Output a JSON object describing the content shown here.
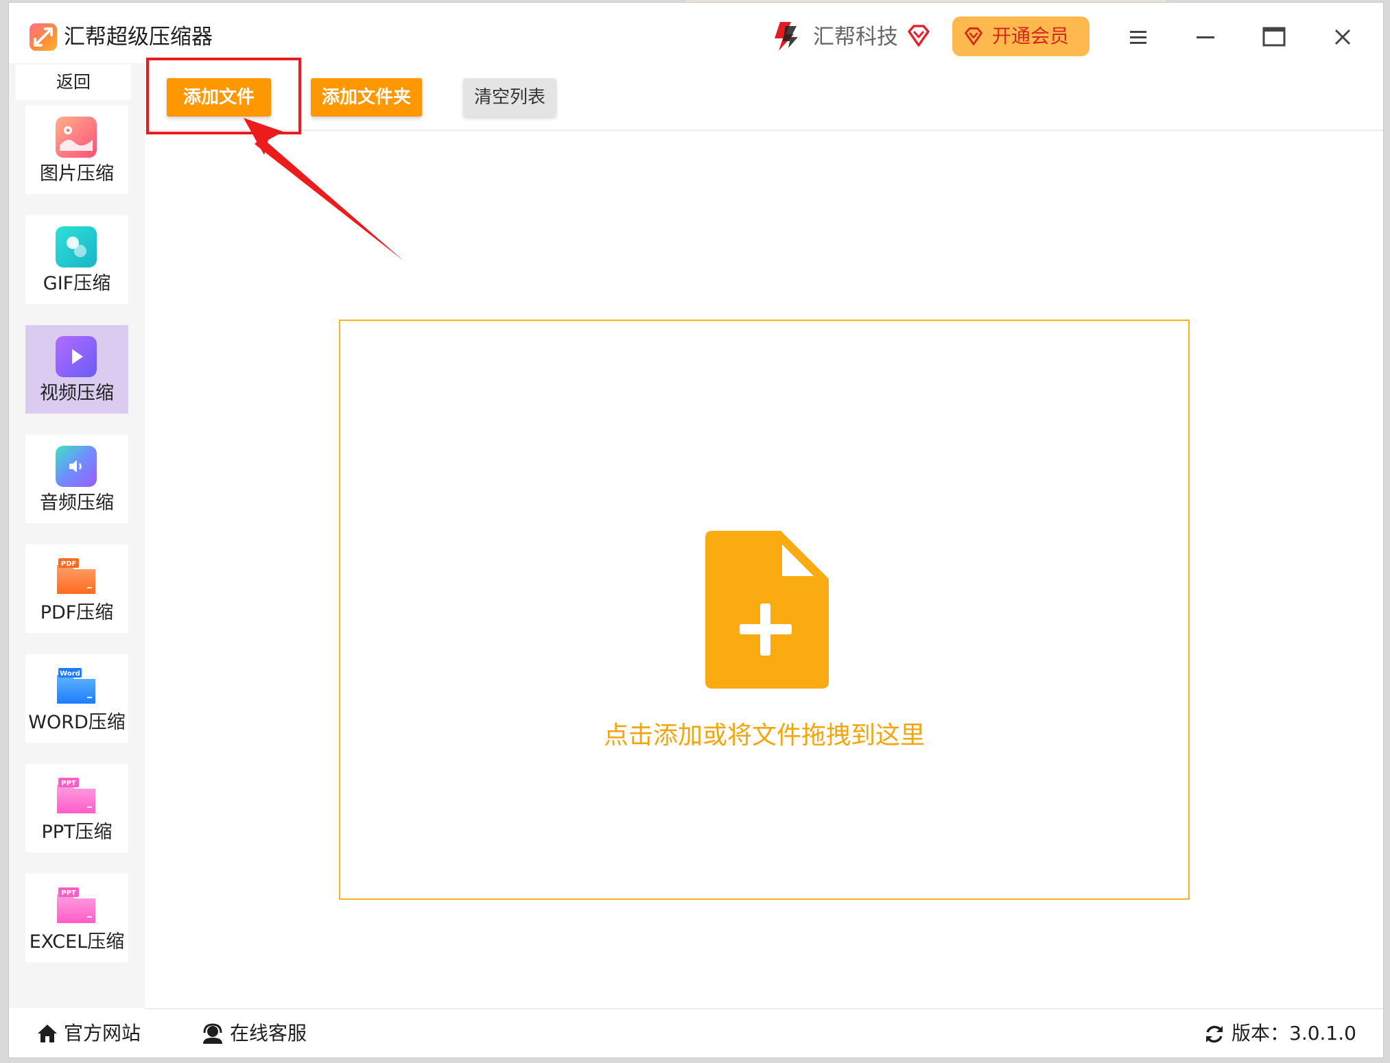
{
  "window": {
    "title": "汇帮超级压缩器",
    "brand": "汇帮科技",
    "vip_label": "开通会员"
  },
  "sidebar": {
    "back_label": "返回",
    "items": [
      {
        "label": "图片压缩",
        "icon": "image-icon"
      },
      {
        "label": "GIF压缩",
        "icon": "gif-icon"
      },
      {
        "label": "视频压缩",
        "icon": "video-icon",
        "active": true
      },
      {
        "label": "音频压缩",
        "icon": "audio-icon"
      },
      {
        "label": "PDF压缩",
        "icon": "pdf-folder-icon",
        "badge": "PDF"
      },
      {
        "label": "WORD压缩",
        "icon": "word-folder-icon",
        "badge": "Word"
      },
      {
        "label": "PPT压缩",
        "icon": "ppt-folder-icon",
        "badge": "PPT"
      },
      {
        "label": "EXCEL压缩",
        "icon": "excel-folder-icon",
        "badge": "PPT"
      }
    ]
  },
  "toolbar": {
    "add_file": "添加文件",
    "add_folder": "添加文件夹",
    "clear_list": "清空列表"
  },
  "dropzone": {
    "hint": "点击添加或将文件拖拽到这里"
  },
  "footer": {
    "website": "官方网站",
    "service": "在线客服",
    "version": "版本：3.0.1.0"
  },
  "colors": {
    "accent": "#ff9700",
    "dropzone_border": "#f5b21e",
    "highlight_annotation": "#ec1c1c",
    "active_sidebar": "#d9ccf0"
  }
}
